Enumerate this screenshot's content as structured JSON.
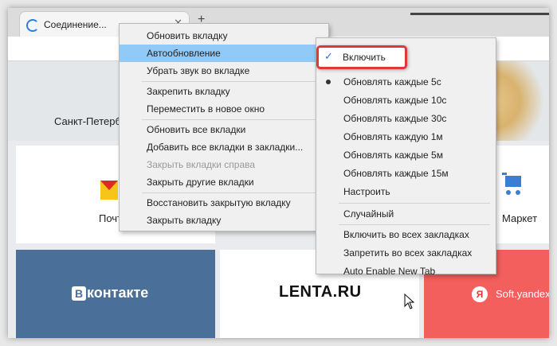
{
  "tab": {
    "title": "Соединение...",
    "close_glyph": "✕",
    "new_tab_glyph": "+"
  },
  "page": {
    "city": "Санкт-Петербург",
    "tiles": {
      "mail": "Почта",
      "market": "Маркет",
      "vk": "контакте",
      "vk_b": "В",
      "lenta": "LENTA.RU",
      "soft": "Soft.yandex",
      "ya_letter": "Я"
    }
  },
  "context_menu": {
    "items": [
      {
        "label": "Обновить вкладку",
        "state": "normal"
      },
      {
        "label": "Автообновление",
        "state": "highlighted",
        "has_submenu": true
      },
      {
        "label": "Убрать звук во вкладке",
        "state": "normal"
      },
      {
        "label": "Закрепить вкладку",
        "state": "normal"
      },
      {
        "label": "Переместить в новое окно",
        "state": "normal"
      },
      {
        "label": "Обновить все вкладки",
        "state": "normal"
      },
      {
        "label": "Добавить все вкладки в закладки...",
        "state": "normal"
      },
      {
        "label": "Закрыть вкладки справа",
        "state": "disabled"
      },
      {
        "label": "Закрыть другие вкладки",
        "state": "normal"
      },
      {
        "label": "Восстановить закрытую вкладку",
        "state": "normal"
      },
      {
        "label": "Закрыть вкладку",
        "state": "normal"
      }
    ],
    "submenu_arrow": "›"
  },
  "submenu": {
    "items": [
      {
        "label": "Включить",
        "mark": "check"
      },
      {
        "label": "Обновлять каждые 5с",
        "mark": "radio"
      },
      {
        "label": "Обновлять каждые 10с"
      },
      {
        "label": "Обновлять каждые 30с"
      },
      {
        "label": "Обновлять каждую 1м"
      },
      {
        "label": "Обновлять каждые 5м"
      },
      {
        "label": "Обновлять каждые 15м"
      },
      {
        "label": "Настроить"
      },
      {
        "label": "Случайный"
      },
      {
        "label": "Включить во всех закладках"
      },
      {
        "label": "Запретить во всех закладках"
      },
      {
        "label": "Auto Enable New Tab"
      }
    ],
    "check_glyph": "✓"
  },
  "colors": {
    "highlight": "#91c9f7",
    "callout_border": "#e0373b",
    "vk_tile": "#4a6f98",
    "soft_tile": "#f25f5c"
  }
}
